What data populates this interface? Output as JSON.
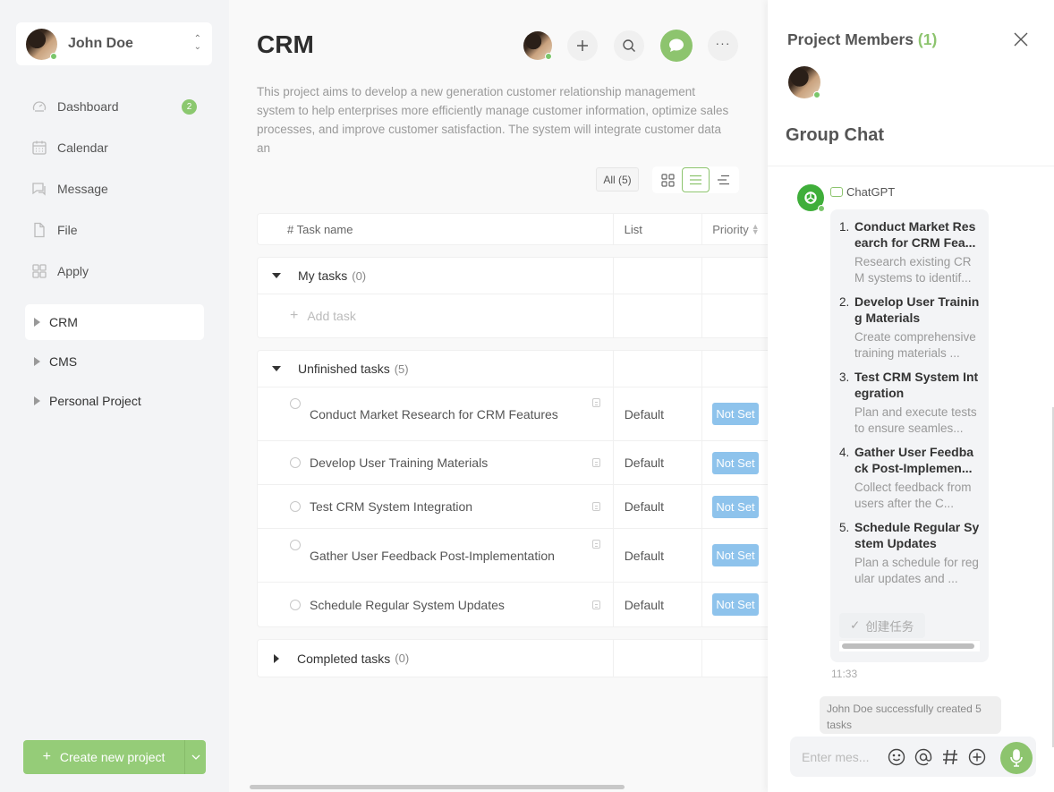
{
  "user": {
    "name": "John Doe",
    "status": "online"
  },
  "sidebar": {
    "nav": [
      {
        "label": "Dashboard",
        "icon": "dashboard-icon",
        "badge": "2"
      },
      {
        "label": "Calendar",
        "icon": "calendar-icon"
      },
      {
        "label": "Message",
        "icon": "message-icon"
      },
      {
        "label": "File",
        "icon": "file-icon"
      },
      {
        "label": "Apply",
        "icon": "apps-icon"
      }
    ],
    "projects": [
      {
        "label": "CRM",
        "active": true
      },
      {
        "label": "CMS"
      },
      {
        "label": "Personal Project"
      }
    ],
    "create_label": "Create new project"
  },
  "main": {
    "title": "CRM",
    "description": "This project aims to develop a new generation customer relationship management system to help enterprises more efficiently manage customer information, optimize sales processes, and improve customer satisfaction. The system will integrate customer data an",
    "filter_label": "All (5)",
    "columns": {
      "task": "# Task name",
      "list": "List",
      "priority": "Priority"
    },
    "groups": {
      "my_tasks": {
        "name": "My tasks",
        "count": "(0)",
        "add_label": "Add task"
      },
      "unfinished": {
        "name": "Unfinished tasks",
        "count": "(5)"
      },
      "completed": {
        "name": "Completed tasks",
        "count": "(0)"
      }
    },
    "tasks": [
      {
        "name": "Conduct Market Research for CRM Features",
        "list": "Default",
        "priority": "Not Set"
      },
      {
        "name": "Develop User Training Materials",
        "list": "Default",
        "priority": "Not Set"
      },
      {
        "name": "Test CRM System Integration",
        "list": "Default",
        "priority": "Not Set"
      },
      {
        "name": "Gather User Feedback Post-Implementation",
        "list": "Default",
        "priority": "Not Set"
      },
      {
        "name": "Schedule Regular System Updates",
        "list": "Default",
        "priority": "Not Set"
      }
    ]
  },
  "panel": {
    "members_title": "Project Members",
    "members_count": "(1)",
    "chat_title": "Group Chat",
    "bot_name": "ChatGPT",
    "suggestions": [
      {
        "num": "1.",
        "title": "Conduct Market Research for CRM Fea...",
        "desc": "Research existing CRM systems to identif..."
      },
      {
        "num": "2.",
        "title": "Develop User Training Materials",
        "desc": "Create comprehensive training materials ..."
      },
      {
        "num": "3.",
        "title": "Test CRM System Integration",
        "desc": "Plan and execute tests to ensure seamles..."
      },
      {
        "num": "4.",
        "title": "Gather User Feedback Post-Implemen...",
        "desc": "Collect feedback from users after the C..."
      },
      {
        "num": "5.",
        "title": "Schedule Regular System Updates",
        "desc": "Plan a schedule for regular updates and ..."
      }
    ],
    "create_task_label": "创建任务",
    "time": "11:33",
    "system_message": "John Doe successfully created 5 tasks",
    "input_placeholder": "Enter mes..."
  },
  "colors": {
    "accent": "#8dc46e",
    "badge_blue": "#8ec3ec",
    "sidebar_bg": "#f3f4f6"
  }
}
